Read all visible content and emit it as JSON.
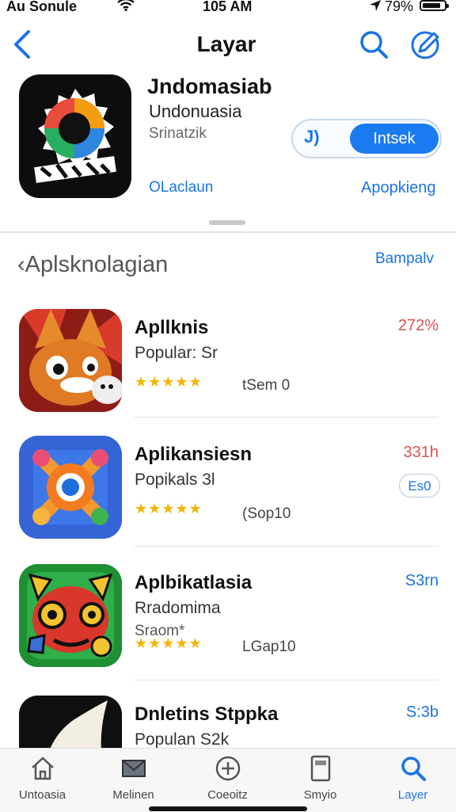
{
  "status_bar": {
    "carrier": "Au Sonule",
    "time": "105 AM",
    "battery_pct": "79%",
    "wifi_icon": "wifi-icon",
    "location_icon": "location-arrow-icon",
    "battery_icon": "battery-icon"
  },
  "nav": {
    "title": "Layar",
    "back_icon": "chevron-left-icon",
    "search_icon": "search-icon",
    "edit_icon": "compose-icon"
  },
  "featured": {
    "title": "Jndomasiab",
    "subtitle": "Undonuasia",
    "size": "Srinatzik",
    "left_link": "OLaclaun",
    "right_link": "Apopkieng",
    "toggle_left": "J)",
    "toggle_right": "Intsek",
    "icon": "app-logo-icon"
  },
  "section": {
    "title": "‹Aplsknolagian",
    "link": "Bampalv"
  },
  "apps": [
    {
      "name": "Apllknis",
      "subtitle": "Popular: Sr",
      "extra": "",
      "rating": "★★★★★",
      "count": "tSem 0",
      "price": "272%",
      "price_color": "#d9534f",
      "button": ""
    },
    {
      "name": "Aplikansiesn",
      "subtitle": "Popikals 3l",
      "extra": "",
      "rating": "★★★★★",
      "count": "(Sop10",
      "price": "331h",
      "price_color": "#d9534f",
      "button": "Es0"
    },
    {
      "name": "Aplbikatlasia",
      "subtitle": "Rradomima",
      "extra": "Sraom*",
      "rating": "★★★★★",
      "count": "LGap10",
      "price": "S3rn",
      "price_color": "#1a73e8",
      "button": ""
    },
    {
      "name": "Dnletins Stppka",
      "subtitle": "Populan S2k",
      "extra": "",
      "rating": "",
      "count": "",
      "price": "S:3b",
      "price_color": "#1a73e8",
      "button": ""
    }
  ],
  "tabs": [
    {
      "label": "Untoasia",
      "icon": "home-icon"
    },
    {
      "label": "Melinen",
      "icon": "mail-icon"
    },
    {
      "label": "Coeoitz",
      "icon": "add-circle-icon"
    },
    {
      "label": "Smyio",
      "icon": "tablet-icon"
    },
    {
      "label": "Layer",
      "icon": "search-icon"
    }
  ],
  "colors": {
    "accent": "#1a73e8",
    "price_red": "#d9534f",
    "star": "#f4b400"
  }
}
